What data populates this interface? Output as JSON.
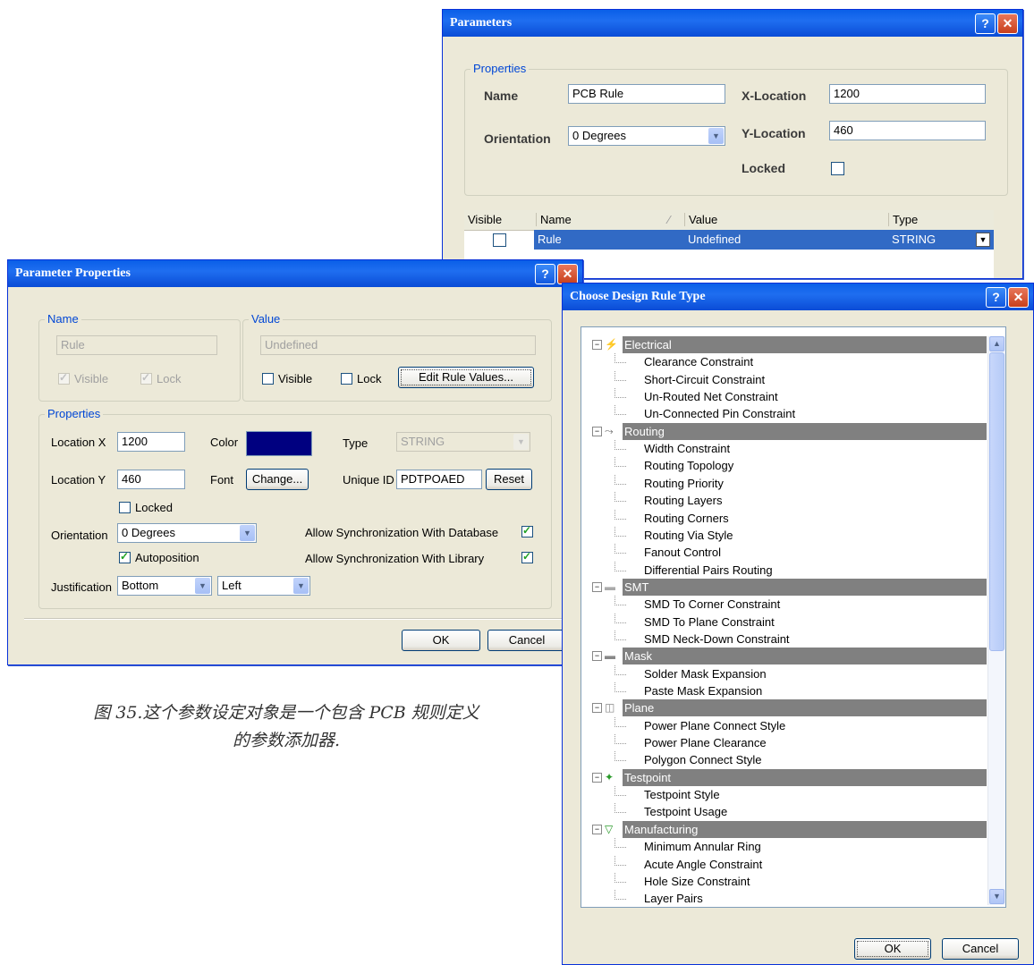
{
  "parameters_dialog": {
    "title": "Parameters",
    "properties_group": "Properties",
    "name_label": "Name",
    "name_value": "PCB Rule",
    "orientation_label": "Orientation",
    "orientation_value": "0 Degrees",
    "xloc_label": "X-Location",
    "xloc_value": "1200",
    "yloc_label": "Y-Location",
    "yloc_value": "460",
    "locked_label": "Locked",
    "locked_checked": false,
    "table": {
      "headers": [
        "Visible",
        "Name",
        "Value",
        "Type"
      ],
      "rows": [
        {
          "visible": false,
          "name": "Rule",
          "value": "Undefined",
          "type": "STRING"
        }
      ]
    }
  },
  "param_props": {
    "title": "Parameter Properties",
    "name_group": "Name",
    "name_value": "Rule",
    "name_visible_label": "Visible",
    "name_lock_label": "Lock",
    "value_group": "Value",
    "value_value": "Undefined",
    "value_visible_label": "Visible",
    "value_lock_label": "Lock",
    "edit_rule_button": "Edit Rule Values...",
    "properties_group": "Properties",
    "location_x_label": "Location X",
    "location_x_value": "1200",
    "location_y_label": "Location Y",
    "location_y_value": "460",
    "color_label": "Color",
    "color_value": "#000080",
    "font_label": "Font",
    "change_button": "Change...",
    "type_label": "Type",
    "type_value": "STRING",
    "unique_id_label": "Unique ID",
    "unique_id_value": "PDTPOAED",
    "reset_button": "Reset",
    "locked_label": "Locked",
    "orientation_label": "Orientation",
    "orientation_value": "0 Degrees",
    "autoposition_label": "Autoposition",
    "sync_db_label": "Allow Synchronization With Database",
    "sync_lib_label": "Allow Synchronization With Library",
    "justification_label": "Justification",
    "justification_v": "Bottom",
    "justification_h": "Left",
    "ok_button": "OK",
    "cancel_button": "Cancel"
  },
  "caption": {
    "line1": "图 35.这个参数设定对象是一个包含 PCB 规则定义",
    "line2": "的参数添加器."
  },
  "rule_dialog": {
    "title": "Choose Design Rule Type",
    "categories": [
      {
        "label": "Electrical",
        "icon": "electrical-icon",
        "items": [
          "Clearance Constraint",
          "Short-Circuit Constraint",
          "Un-Routed Net Constraint",
          "Un-Connected Pin Constraint"
        ]
      },
      {
        "label": "Routing",
        "icon": "routing-icon",
        "items": [
          "Width Constraint",
          "Routing Topology",
          "Routing Priority",
          "Routing Layers",
          "Routing Corners",
          "Routing Via Style",
          "Fanout Control",
          "Differential Pairs Routing"
        ]
      },
      {
        "label": "SMT",
        "icon": "smt-icon",
        "items": [
          "SMD To Corner Constraint",
          "SMD To Plane Constraint",
          "SMD Neck-Down Constraint"
        ]
      },
      {
        "label": "Mask",
        "icon": "mask-icon",
        "items": [
          "Solder Mask Expansion",
          "Paste Mask Expansion"
        ]
      },
      {
        "label": "Plane",
        "icon": "plane-icon",
        "items": [
          "Power Plane Connect Style",
          "Power Plane Clearance",
          "Polygon Connect Style"
        ]
      },
      {
        "label": "Testpoint",
        "icon": "testpoint-icon",
        "items": [
          "Testpoint Style",
          "Testpoint Usage"
        ]
      },
      {
        "label": "Manufacturing",
        "icon": "manufacturing-icon",
        "items": [
          "Minimum Annular Ring",
          "Acute Angle Constraint",
          "Hole Size Constraint",
          "Layer Pairs"
        ]
      }
    ],
    "ok_button": "OK",
    "cancel_button": "Cancel"
  },
  "colors": {
    "title_bar": "#0a5fe8",
    "selection": "#316ac5",
    "category_bg": "#808080",
    "dialog_bg": "#ece9d8"
  }
}
